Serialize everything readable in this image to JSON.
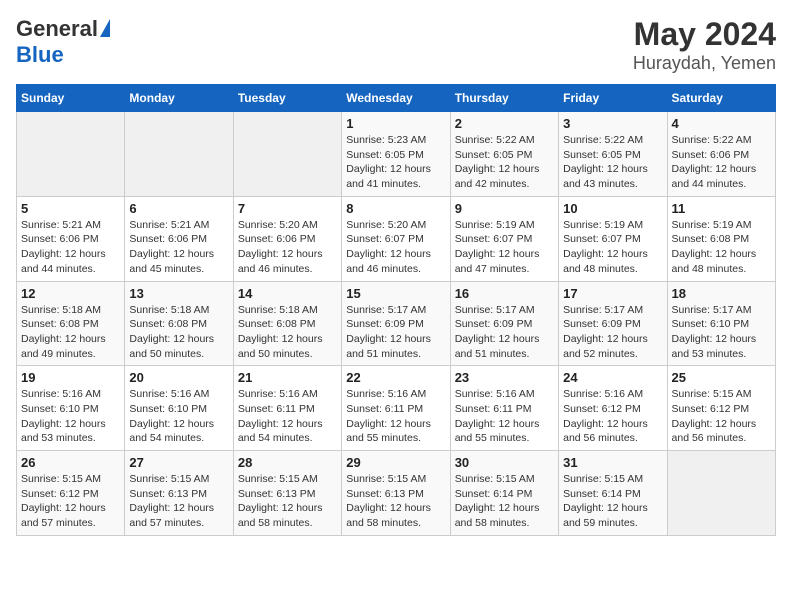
{
  "logo": {
    "general": "General",
    "blue": "Blue"
  },
  "title": "May 2024",
  "location": "Huraydah, Yemen",
  "days_of_week": [
    "Sunday",
    "Monday",
    "Tuesday",
    "Wednesday",
    "Thursday",
    "Friday",
    "Saturday"
  ],
  "weeks": [
    [
      {
        "day": "",
        "info": ""
      },
      {
        "day": "",
        "info": ""
      },
      {
        "day": "",
        "info": ""
      },
      {
        "day": "1",
        "info": "Sunrise: 5:23 AM\nSunset: 6:05 PM\nDaylight: 12 hours\nand 41 minutes."
      },
      {
        "day": "2",
        "info": "Sunrise: 5:22 AM\nSunset: 6:05 PM\nDaylight: 12 hours\nand 42 minutes."
      },
      {
        "day": "3",
        "info": "Sunrise: 5:22 AM\nSunset: 6:05 PM\nDaylight: 12 hours\nand 43 minutes."
      },
      {
        "day": "4",
        "info": "Sunrise: 5:22 AM\nSunset: 6:06 PM\nDaylight: 12 hours\nand 44 minutes."
      }
    ],
    [
      {
        "day": "5",
        "info": "Sunrise: 5:21 AM\nSunset: 6:06 PM\nDaylight: 12 hours\nand 44 minutes."
      },
      {
        "day": "6",
        "info": "Sunrise: 5:21 AM\nSunset: 6:06 PM\nDaylight: 12 hours\nand 45 minutes."
      },
      {
        "day": "7",
        "info": "Sunrise: 5:20 AM\nSunset: 6:06 PM\nDaylight: 12 hours\nand 46 minutes."
      },
      {
        "day": "8",
        "info": "Sunrise: 5:20 AM\nSunset: 6:07 PM\nDaylight: 12 hours\nand 46 minutes."
      },
      {
        "day": "9",
        "info": "Sunrise: 5:19 AM\nSunset: 6:07 PM\nDaylight: 12 hours\nand 47 minutes."
      },
      {
        "day": "10",
        "info": "Sunrise: 5:19 AM\nSunset: 6:07 PM\nDaylight: 12 hours\nand 48 minutes."
      },
      {
        "day": "11",
        "info": "Sunrise: 5:19 AM\nSunset: 6:08 PM\nDaylight: 12 hours\nand 48 minutes."
      }
    ],
    [
      {
        "day": "12",
        "info": "Sunrise: 5:18 AM\nSunset: 6:08 PM\nDaylight: 12 hours\nand 49 minutes."
      },
      {
        "day": "13",
        "info": "Sunrise: 5:18 AM\nSunset: 6:08 PM\nDaylight: 12 hours\nand 50 minutes."
      },
      {
        "day": "14",
        "info": "Sunrise: 5:18 AM\nSunset: 6:08 PM\nDaylight: 12 hours\nand 50 minutes."
      },
      {
        "day": "15",
        "info": "Sunrise: 5:17 AM\nSunset: 6:09 PM\nDaylight: 12 hours\nand 51 minutes."
      },
      {
        "day": "16",
        "info": "Sunrise: 5:17 AM\nSunset: 6:09 PM\nDaylight: 12 hours\nand 51 minutes."
      },
      {
        "day": "17",
        "info": "Sunrise: 5:17 AM\nSunset: 6:09 PM\nDaylight: 12 hours\nand 52 minutes."
      },
      {
        "day": "18",
        "info": "Sunrise: 5:17 AM\nSunset: 6:10 PM\nDaylight: 12 hours\nand 53 minutes."
      }
    ],
    [
      {
        "day": "19",
        "info": "Sunrise: 5:16 AM\nSunset: 6:10 PM\nDaylight: 12 hours\nand 53 minutes."
      },
      {
        "day": "20",
        "info": "Sunrise: 5:16 AM\nSunset: 6:10 PM\nDaylight: 12 hours\nand 54 minutes."
      },
      {
        "day": "21",
        "info": "Sunrise: 5:16 AM\nSunset: 6:11 PM\nDaylight: 12 hours\nand 54 minutes."
      },
      {
        "day": "22",
        "info": "Sunrise: 5:16 AM\nSunset: 6:11 PM\nDaylight: 12 hours\nand 55 minutes."
      },
      {
        "day": "23",
        "info": "Sunrise: 5:16 AM\nSunset: 6:11 PM\nDaylight: 12 hours\nand 55 minutes."
      },
      {
        "day": "24",
        "info": "Sunrise: 5:16 AM\nSunset: 6:12 PM\nDaylight: 12 hours\nand 56 minutes."
      },
      {
        "day": "25",
        "info": "Sunrise: 5:15 AM\nSunset: 6:12 PM\nDaylight: 12 hours\nand 56 minutes."
      }
    ],
    [
      {
        "day": "26",
        "info": "Sunrise: 5:15 AM\nSunset: 6:12 PM\nDaylight: 12 hours\nand 57 minutes."
      },
      {
        "day": "27",
        "info": "Sunrise: 5:15 AM\nSunset: 6:13 PM\nDaylight: 12 hours\nand 57 minutes."
      },
      {
        "day": "28",
        "info": "Sunrise: 5:15 AM\nSunset: 6:13 PM\nDaylight: 12 hours\nand 58 minutes."
      },
      {
        "day": "29",
        "info": "Sunrise: 5:15 AM\nSunset: 6:13 PM\nDaylight: 12 hours\nand 58 minutes."
      },
      {
        "day": "30",
        "info": "Sunrise: 5:15 AM\nSunset: 6:14 PM\nDaylight: 12 hours\nand 58 minutes."
      },
      {
        "day": "31",
        "info": "Sunrise: 5:15 AM\nSunset: 6:14 PM\nDaylight: 12 hours\nand 59 minutes."
      },
      {
        "day": "",
        "info": ""
      }
    ]
  ]
}
